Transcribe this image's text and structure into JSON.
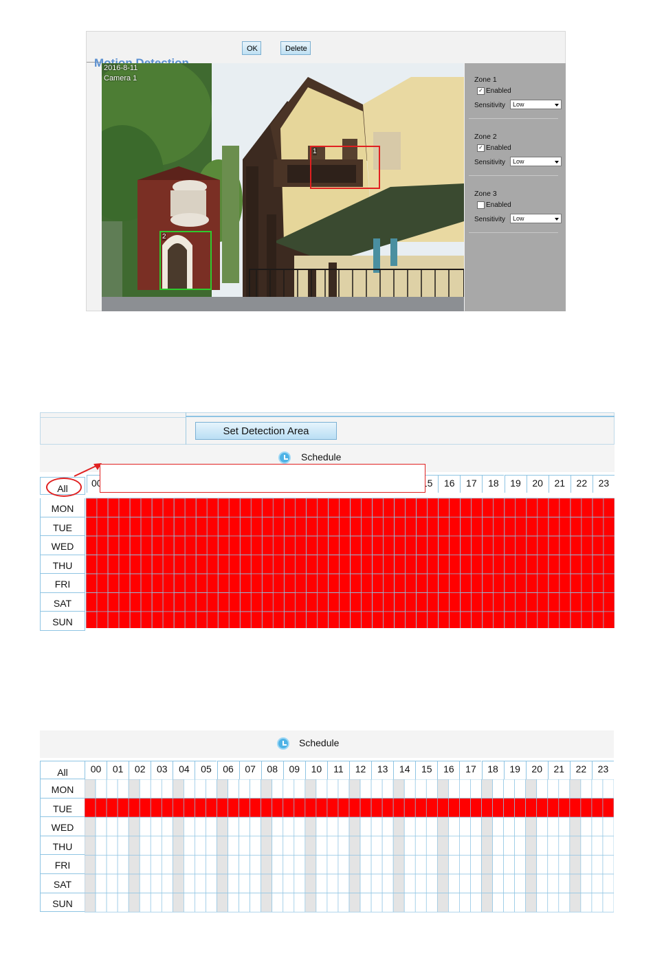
{
  "motion_detection": {
    "title": "Motion Detection",
    "ok_label": "OK",
    "delete_label": "Delete",
    "overlay_date": "2016-8-11",
    "overlay_camera": "Camera 1",
    "zones": [
      {
        "title": "Zone 1",
        "enabled_label": "Enabled",
        "enabled": true,
        "sensitivity_label": "Sensitivity",
        "sensitivity": "Low",
        "box_label": "1",
        "box_color": "#e02020"
      },
      {
        "title": "Zone 2",
        "enabled_label": "Enabled",
        "enabled": true,
        "sensitivity_label": "Sensitivity",
        "sensitivity": "Low",
        "box_label": "2",
        "box_color": "#2ecc2e"
      },
      {
        "title": "Zone 3",
        "enabled_label": "Enabled",
        "enabled": false,
        "sensitivity_label": "Sensitivity",
        "sensitivity": "Low"
      }
    ]
  },
  "schedule_all": {
    "set_detection_area_label": "Set Detection Area",
    "schedule_title": "Schedule",
    "all_label": "All",
    "first_hour_label": "00",
    "visible_hours": [
      "15",
      "16",
      "17",
      "18",
      "19",
      "20",
      "21",
      "22",
      "23"
    ],
    "days": [
      "MON",
      "TUE",
      "WED",
      "THU",
      "FRI",
      "SAT",
      "SUN"
    ],
    "selected_days": [
      "MON",
      "TUE",
      "WED",
      "THU",
      "FRI",
      "SAT",
      "SUN"
    ],
    "selected_color": "#ff0000",
    "annotation_color": "#e02020"
  },
  "schedule_tue": {
    "schedule_title": "Schedule",
    "all_label": "All",
    "hours": [
      "00",
      "01",
      "02",
      "03",
      "04",
      "05",
      "06",
      "07",
      "08",
      "09",
      "10",
      "11",
      "12",
      "13",
      "14",
      "15",
      "16",
      "17",
      "18",
      "19",
      "20",
      "21",
      "22",
      "23"
    ],
    "days": [
      "MON",
      "TUE",
      "WED",
      "THU",
      "FRI",
      "SAT",
      "SUN"
    ],
    "selected_days": [
      "TUE"
    ],
    "selected_color": "#ff0000",
    "stripe_color": "#e4e4e4"
  }
}
